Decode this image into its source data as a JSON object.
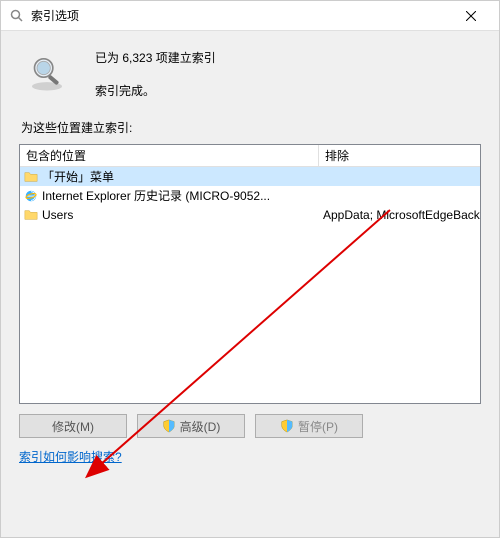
{
  "window": {
    "title": "索引选项",
    "close_label": "×"
  },
  "summary": {
    "line1": "已为 6,323 项建立索引",
    "line2": "索引完成。"
  },
  "locations": {
    "section_label": "为这些位置建立索引:",
    "col_included": "包含的位置",
    "col_exclude": "排除",
    "rows": [
      {
        "name": "「开始」菜单",
        "exclude": "",
        "icon": "folder",
        "selected": true
      },
      {
        "name": "Internet Explorer 历史记录 (MICRO-9052...",
        "exclude": "",
        "icon": "ie",
        "selected": false
      },
      {
        "name": "Users",
        "exclude": "AppData; MicrosoftEdgeBackups; AppData",
        "icon": "folder",
        "selected": false
      }
    ]
  },
  "buttons": {
    "modify": "修改(M)",
    "advanced": "高级(D)",
    "pause": "暂停(P)"
  },
  "link_text": "索引如何影响搜索?"
}
